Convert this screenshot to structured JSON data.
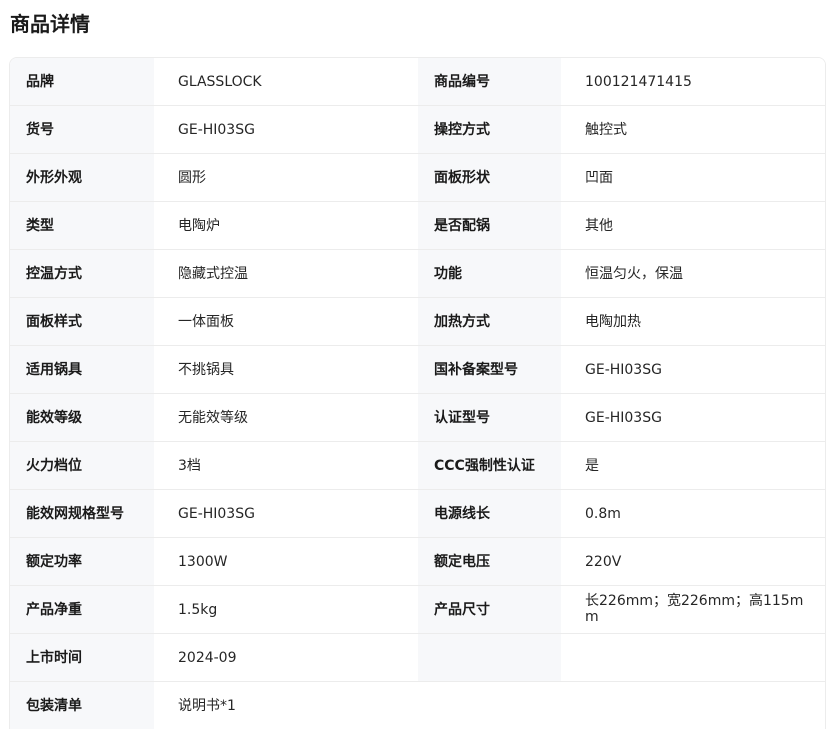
{
  "section": {
    "title": "商品详情"
  },
  "specs": {
    "rows": [
      {
        "l1": "品牌",
        "v1": "GLASSLOCK",
        "l2": "商品编号",
        "v2": "100121471415"
      },
      {
        "l1": "货号",
        "v1": "GE-HI03SG",
        "l2": "操控方式",
        "v2": "触控式"
      },
      {
        "l1": "外形外观",
        "v1": "圆形",
        "l2": "面板形状",
        "v2": "凹面"
      },
      {
        "l1": "类型",
        "v1": "电陶炉",
        "l2": "是否配锅",
        "v2": "其他"
      },
      {
        "l1": "控温方式",
        "v1": "隐藏式控温",
        "l2": "功能",
        "v2": "恒温匀火，保温"
      },
      {
        "l1": "面板样式",
        "v1": "一体面板",
        "l2": "加热方式",
        "v2": "电陶加热"
      },
      {
        "l1": "适用锅具",
        "v1": "不挑锅具",
        "l2": "国补备案型号",
        "v2": "GE-HI03SG"
      },
      {
        "l1": "能效等级",
        "v1": "无能效等级",
        "l2": "认证型号",
        "v2": "GE-HI03SG"
      },
      {
        "l1": "火力档位",
        "v1": "3档",
        "l2": "CCC强制性认证",
        "v2": "是"
      },
      {
        "l1": "能效网规格型号",
        "v1": "GE-HI03SG",
        "l2": "电源线长",
        "v2": "0.8m"
      },
      {
        "l1": "额定功率",
        "v1": "1300W",
        "l2": "额定电压",
        "v2": "220V"
      },
      {
        "l1": "产品净重",
        "v1": "1.5kg",
        "l2": "产品尺寸",
        "v2": "长226mm；宽226mm；高115mm"
      },
      {
        "l1": "上市时间",
        "v1": "2024-09",
        "l2": "",
        "v2": ""
      }
    ],
    "last_row": {
      "label": "包装清单",
      "value": "说明书*1"
    }
  }
}
